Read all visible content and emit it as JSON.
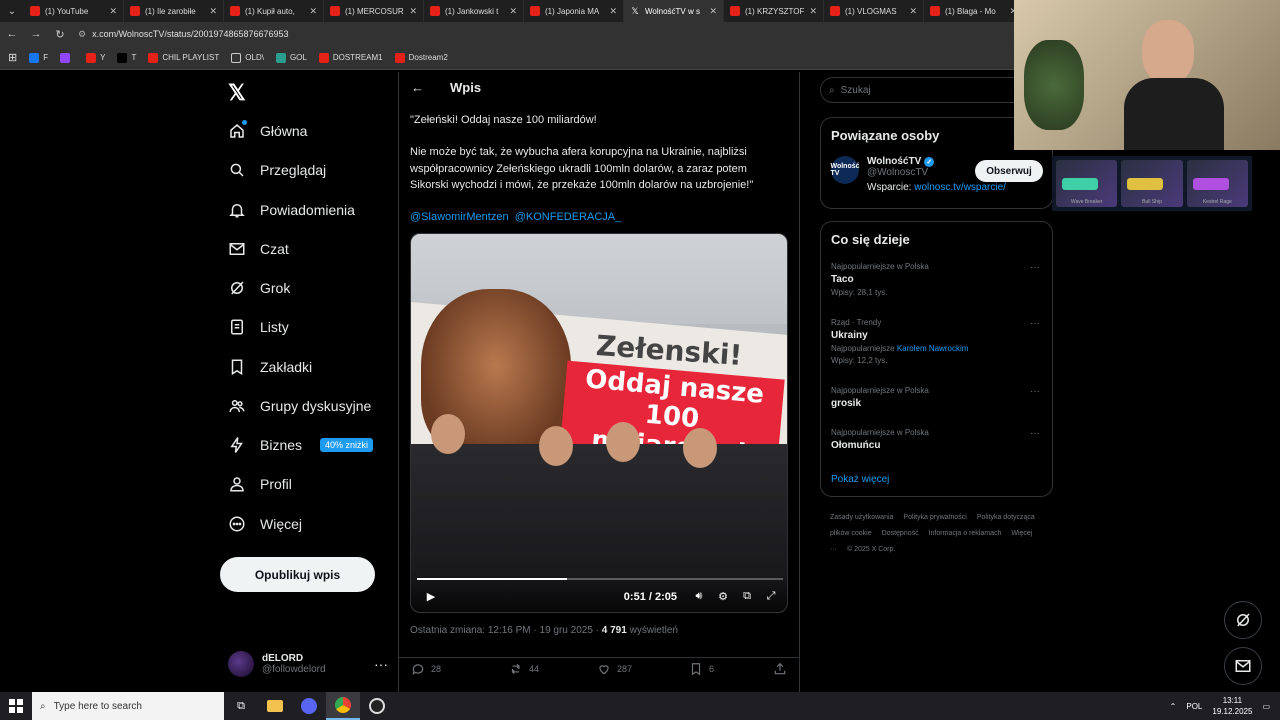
{
  "browser": {
    "tabs": [
      {
        "title": "(1) YouTube",
        "icon": "youtube",
        "active": false
      },
      {
        "title": "(1) Ile zarobiłe",
        "icon": "youtube",
        "active": false
      },
      {
        "title": "(1) Kupił auto,",
        "icon": "youtube",
        "active": false
      },
      {
        "title": "(1) MERCOSUR",
        "icon": "youtube",
        "active": false
      },
      {
        "title": "(1) Jankowski t",
        "icon": "youtube",
        "active": false
      },
      {
        "title": "(1) Japonia MA",
        "icon": "youtube",
        "active": false
      },
      {
        "title": "WolnośćTV w s",
        "icon": "x",
        "active": true
      },
      {
        "title": "(1) KRZYSZTOF",
        "icon": "youtube",
        "active": false
      },
      {
        "title": "(1) VLOGMAS",
        "icon": "youtube",
        "active": false
      },
      {
        "title": "(1) Blaga - Mo",
        "icon": "youtube",
        "active": false
      }
    ],
    "url": "x.com/WolnoscTV/status/2001974865876676953",
    "bookmarks": [
      {
        "label": "F",
        "color": "#1877f2"
      },
      {
        "label": "",
        "color": "#9146ff"
      },
      {
        "label": "Y",
        "color": "#e62117"
      },
      {
        "label": "T",
        "color": "#000000"
      },
      {
        "label": "CHIL PLAYLIST",
        "color": "#e62117"
      },
      {
        "label": "OLD\\",
        "color": "folder"
      },
      {
        "label": "GOL",
        "color": "#2a9d8f"
      },
      {
        "label": "DOSTREAM1",
        "color": "#e62117"
      },
      {
        "label": "Dostream2",
        "color": "#e62117"
      }
    ]
  },
  "nav": {
    "items": [
      {
        "label": "Główna",
        "icon": "home-icon"
      },
      {
        "label": "Przeglądaj",
        "icon": "search-icon"
      },
      {
        "label": "Powiadomienia",
        "icon": "bell-icon"
      },
      {
        "label": "Czat",
        "icon": "mail-icon"
      },
      {
        "label": "Grok",
        "icon": "grok-icon"
      },
      {
        "label": "Listy",
        "icon": "list-icon"
      },
      {
        "label": "Zakładki",
        "icon": "bookmark-icon"
      },
      {
        "label": "Grupy dyskusyjne",
        "icon": "people-icon"
      },
      {
        "label": "Biznes",
        "icon": "bolt-icon"
      },
      {
        "label": "Profil",
        "icon": "person-icon"
      },
      {
        "label": "Więcej",
        "icon": "more-circle-icon"
      }
    ],
    "promo": "40% zniżki",
    "post_button": "Opublikuj wpis",
    "account": {
      "name": "dELORD",
      "handle": "@followdelord"
    }
  },
  "post": {
    "header": "Wpis",
    "quote": "\"Zełeński! Oddaj nasze 100 miliardów!",
    "body": "Nie może być tak, że wybucha afera korupcyjna na Ukrainie, najbliżsi współpracownicy Zełeńskiego ukradli 100mln dolarów, a zaraz potem Sikorski wychodzi i mówi, że przekaże 100mln dolarów na uzbrojenie!\"",
    "mention1": "@SlawomirMentzen",
    "mention2": "@KONFEDERACJA_",
    "banner_line1": "Zełenski!",
    "banner_line2": "Oddaj nasze 100 miliardów!",
    "video": {
      "time": "0:51 / 2:05",
      "progress": 0.41
    },
    "meta_prefix": "Ostatnia zmiana: 12:16 PM · 19 gru 2025 · ",
    "views": "4 791",
    "views_label": " wyświetleń",
    "replies": "28",
    "reposts": "44",
    "likes": "287",
    "bookmarks": "6"
  },
  "right": {
    "search_placeholder": "Szukaj",
    "related_title": "Powiązane osoby",
    "person": {
      "avatar_text": "Wolność TV",
      "name": "WolnośćTV",
      "handle": "@WolnoscTV",
      "bio_prefix": "Wsparcie: ",
      "bio_link": "wolnosc.tv/wsparcie/",
      "follow": "Obserwuj"
    },
    "trends_title": "Co się dzieje",
    "trends": [
      {
        "context": "Najpopularniejsze w Polska",
        "name": "Taco",
        "count": "Wpisy: 28,1 tys.",
        "extra": ""
      },
      {
        "context": "Rząd · Trendy",
        "name": "Ukrainy",
        "count": "Wpisy: 12,2 tys.",
        "extra": "Najpopularniejsze Karolem Nawrockim"
      },
      {
        "context": "Najpopularniejsze w Polska",
        "name": "grosik",
        "count": "",
        "extra": ""
      },
      {
        "context": "Najpopularniejsze w Polska",
        "name": "Ołomuńcu",
        "count": "",
        "extra": ""
      }
    ],
    "show_more": "Pokaż więcej",
    "footer": [
      "Zasady użytkowania",
      "Polityka prywatności",
      "Polityka dotycząca plików cookie",
      "Dostępność",
      "Informacja o reklamach",
      "Więcej ···",
      "© 2025 X Corp."
    ]
  },
  "overlay": {
    "skins": [
      "Wave Breaker",
      "Bull Ship",
      "Kestrel Rage"
    ]
  },
  "taskbar": {
    "search_placeholder": "Type here to search",
    "lang": "POL",
    "time": "13:11",
    "date": "19.12.2025"
  }
}
